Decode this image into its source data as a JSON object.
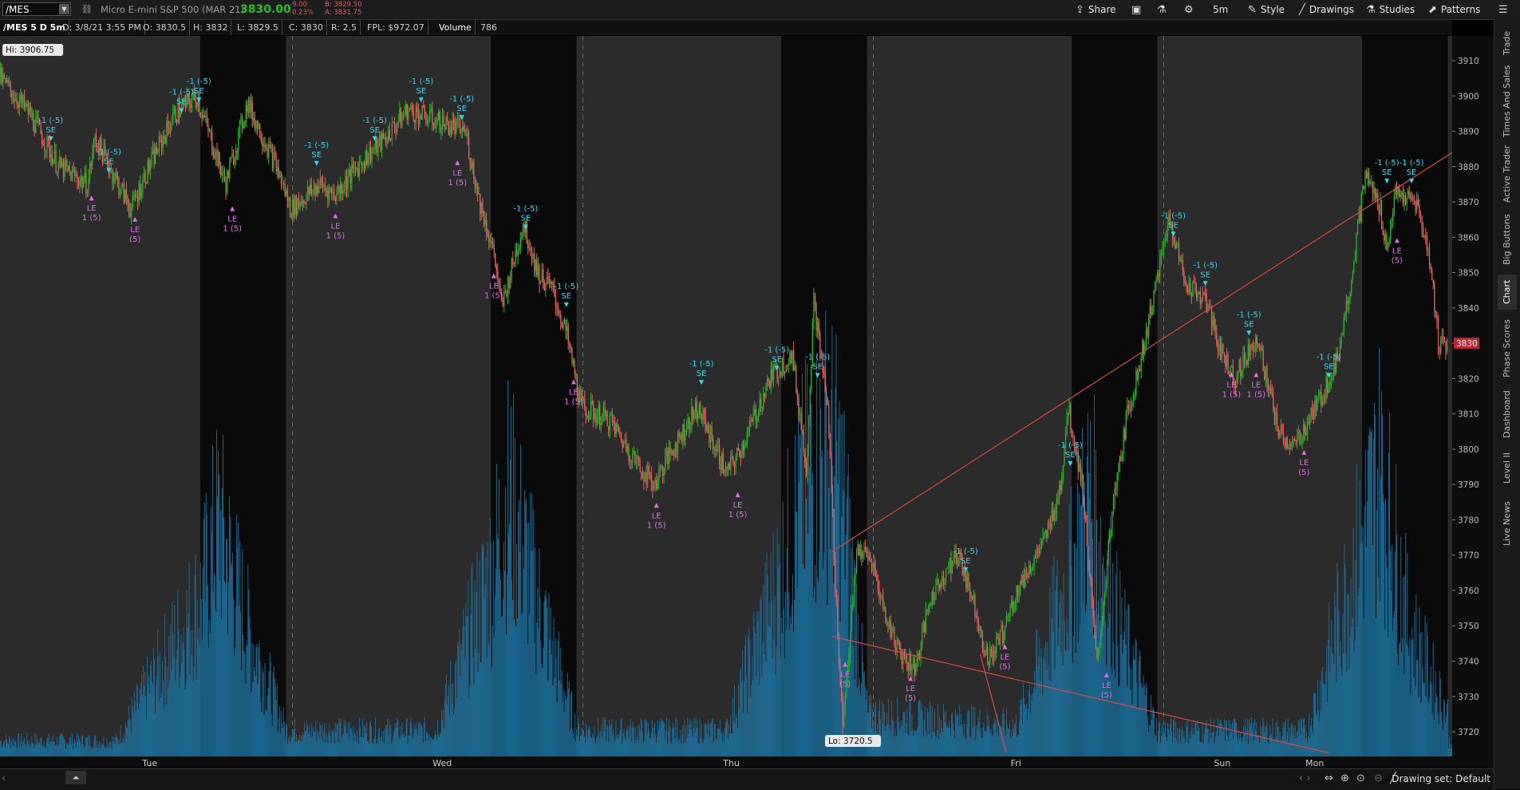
{
  "header": {
    "symbol": "/MES",
    "description": "Micro E-mini S&P 500 (MAR 21)",
    "last": "3830.00",
    "change": "-9.00",
    "change_pct": "-0.23%",
    "bid": "B: 3829.50",
    "ask": "A: 3831.75"
  },
  "toolbar": {
    "share": "Share",
    "timeframe": "5m",
    "style": "Style",
    "drawings": "Drawings",
    "studies": "Studies",
    "patterns": "Patterns"
  },
  "infobar": {
    "title": "/MES 5 D 5m",
    "date": "D: 3/8/21 3:55 PM",
    "open": "O: 3830.5",
    "high": "H: 3832",
    "low": "L: 3829.5",
    "close": "C: 3830",
    "range": "R: 2.5",
    "fpl": "FPL: $972.07",
    "volume_label": "Volume",
    "volume_value": "786"
  },
  "sidebar": {
    "tabs": [
      "Trade",
      "Times And Sales",
      "Active Trader",
      "Big Buttons",
      "Chart",
      "Phase Scores",
      "Dashboard",
      "Level II",
      "Live News"
    ],
    "active": "Chart"
  },
  "bottom": {
    "drawing_set": "Drawing set: Default"
  },
  "colors": {
    "up": "#22b822",
    "down": "#e86060",
    "volume": "#1d6f9a",
    "trendline": "#e04848",
    "se": "#35d7f0",
    "le": "#e070e8",
    "session_dark": "#0a0a0a",
    "session_light": "#2b2b2b"
  },
  "chart_data": {
    "type": "candlestick",
    "ylim": [
      3713,
      3917
    ],
    "y_ticks": [
      3720,
      3730,
      3740,
      3750,
      3760,
      3770,
      3780,
      3790,
      3800,
      3810,
      3820,
      3830,
      3840,
      3850,
      3860,
      3870,
      3880,
      3890,
      3900,
      3910
    ],
    "x_labels": [
      {
        "label": "Tue",
        "t": 0.065
      },
      {
        "label": "Wed",
        "t": 0.265
      },
      {
        "label": "Thu",
        "t": 0.465
      },
      {
        "label": "Fri",
        "t": 0.663
      },
      {
        "label": "Sun",
        "t": 0.803
      },
      {
        "label": "Mon",
        "t": 0.866
      }
    ],
    "dark_sessions": [
      [
        0.138,
        0.197
      ],
      [
        0.338,
        0.397
      ],
      [
        0.538,
        0.597
      ],
      [
        0.738,
        0.797
      ],
      [
        0.938,
        0.997
      ]
    ],
    "hi_label": "Hi: 3906.75",
    "lo_label": "Lo: 3720.5",
    "price_tag": "3830",
    "path": [
      [
        0.0,
        3905
      ],
      [
        0.02,
        3895
      ],
      [
        0.04,
        3880
      ],
      [
        0.06,
        3875
      ],
      [
        0.065,
        3888
      ],
      [
        0.09,
        3868
      ],
      [
        0.1,
        3878
      ],
      [
        0.12,
        3895
      ],
      [
        0.135,
        3900
      ],
      [
        0.155,
        3875
      ],
      [
        0.17,
        3898
      ],
      [
        0.19,
        3880
      ],
      [
        0.2,
        3868
      ],
      [
        0.22,
        3875
      ],
      [
        0.23,
        3872
      ],
      [
        0.25,
        3882
      ],
      [
        0.265,
        3888
      ],
      [
        0.28,
        3896
      ],
      [
        0.3,
        3893
      ],
      [
        0.32,
        3890
      ],
      [
        0.33,
        3870
      ],
      [
        0.34,
        3855
      ],
      [
        0.345,
        3840
      ],
      [
        0.36,
        3864
      ],
      [
        0.37,
        3850
      ],
      [
        0.38,
        3845
      ],
      [
        0.39,
        3832
      ],
      [
        0.4,
        3812
      ],
      [
        0.42,
        3808
      ],
      [
        0.44,
        3795
      ],
      [
        0.45,
        3790
      ],
      [
        0.46,
        3798
      ],
      [
        0.48,
        3812
      ],
      [
        0.5,
        3793
      ],
      [
        0.51,
        3800
      ],
      [
        0.53,
        3820
      ],
      [
        0.545,
        3827
      ],
      [
        0.555,
        3795
      ],
      [
        0.56,
        3842
      ],
      [
        0.57,
        3810
      ],
      [
        0.575,
        3760
      ],
      [
        0.58,
        3722
      ],
      [
        0.59,
        3772
      ],
      [
        0.6,
        3768
      ],
      [
        0.61,
        3752
      ],
      [
        0.62,
        3742
      ],
      [
        0.63,
        3738
      ],
      [
        0.64,
        3757
      ],
      [
        0.65,
        3765
      ],
      [
        0.66,
        3770
      ],
      [
        0.67,
        3757
      ],
      [
        0.68,
        3740
      ],
      [
        0.69,
        3748
      ],
      [
        0.7,
        3760
      ],
      [
        0.72,
        3775
      ],
      [
        0.73,
        3790
      ],
      [
        0.735,
        3812
      ],
      [
        0.745,
        3790
      ],
      [
        0.755,
        3738
      ],
      [
        0.765,
        3780
      ],
      [
        0.775,
        3808
      ],
      [
        0.785,
        3825
      ],
      [
        0.795,
        3845
      ],
      [
        0.805,
        3866
      ],
      [
        0.815,
        3848
      ],
      [
        0.83,
        3842
      ],
      [
        0.84,
        3828
      ],
      [
        0.85,
        3820
      ],
      [
        0.865,
        3832
      ],
      [
        0.88,
        3805
      ],
      [
        0.89,
        3800
      ],
      [
        0.91,
        3815
      ],
      [
        0.92,
        3825
      ],
      [
        0.93,
        3848
      ],
      [
        0.94,
        3878
      ],
      [
        0.95,
        3868
      ],
      [
        0.955,
        3856
      ],
      [
        0.96,
        3872
      ],
      [
        0.975,
        3870
      ],
      [
        0.985,
        3852
      ],
      [
        0.99,
        3830
      ],
      [
        0.997,
        3830
      ]
    ],
    "volume_profile": [
      [
        0.0,
        0.03
      ],
      [
        0.08,
        0.03
      ],
      [
        0.138,
        0.3
      ],
      [
        0.15,
        0.45
      ],
      [
        0.17,
        0.25
      ],
      [
        0.197,
        0.05
      ],
      [
        0.3,
        0.05
      ],
      [
        0.338,
        0.35
      ],
      [
        0.35,
        0.5
      ],
      [
        0.37,
        0.3
      ],
      [
        0.397,
        0.05
      ],
      [
        0.5,
        0.05
      ],
      [
        0.538,
        0.35
      ],
      [
        0.55,
        0.48
      ],
      [
        0.57,
        0.6
      ],
      [
        0.58,
        0.5
      ],
      [
        0.597,
        0.08
      ],
      [
        0.7,
        0.06
      ],
      [
        0.738,
        0.35
      ],
      [
        0.75,
        0.5
      ],
      [
        0.77,
        0.25
      ],
      [
        0.797,
        0.05
      ],
      [
        0.9,
        0.05
      ],
      [
        0.938,
        0.42
      ],
      [
        0.95,
        0.55
      ],
      [
        0.97,
        0.25
      ],
      [
        0.997,
        0.08
      ]
    ],
    "trendlines": [
      [
        [
          0.573,
          3771
        ],
        [
          1.0,
          3884
        ]
      ],
      [
        [
          0.573,
          3747
        ],
        [
          0.915,
          3714
        ]
      ],
      [
        [
          0.675,
          3742
        ],
        [
          0.693,
          3714
        ]
      ]
    ],
    "signals": [
      {
        "t": 0.035,
        "p": 3887,
        "type": "SE",
        "label": "-1 (-5)"
      },
      {
        "t": 0.075,
        "p": 3878,
        "type": "SE",
        "label": "-1 (-5)"
      },
      {
        "t": 0.125,
        "p": 3895,
        "type": "SE",
        "label": "-1 (-5)"
      },
      {
        "t": 0.137,
        "p": 3898,
        "type": "SE",
        "label": "-1 (-5)"
      },
      {
        "t": 0.218,
        "p": 3880,
        "type": "SE",
        "label": "-1 (-5)"
      },
      {
        "t": 0.258,
        "p": 3887,
        "type": "SE",
        "label": "-1 (-5)"
      },
      {
        "t": 0.29,
        "p": 3898,
        "type": "SE",
        "label": "-1 (-5)"
      },
      {
        "t": 0.318,
        "p": 3893,
        "type": "SE",
        "label": "-1 (-5)"
      },
      {
        "t": 0.362,
        "p": 3862,
        "type": "SE",
        "label": "-1 (-5)"
      },
      {
        "t": 0.39,
        "p": 3840,
        "type": "SE",
        "label": "-1 (-5)"
      },
      {
        "t": 0.483,
        "p": 3818,
        "type": "SE",
        "label": "-1 (-5)"
      },
      {
        "t": 0.535,
        "p": 3822,
        "type": "SE",
        "label": "-1 (-5)"
      },
      {
        "t": 0.563,
        "p": 3820,
        "type": "SE",
        "label": "-1 (-5)"
      },
      {
        "t": 0.665,
        "p": 3765,
        "type": "SE",
        "label": "-1 (-5)"
      },
      {
        "t": 0.737,
        "p": 3795,
        "type": "SE",
        "label": "-1 (-5)"
      },
      {
        "t": 0.808,
        "p": 3860,
        "type": "SE",
        "label": "-1 (-5)"
      },
      {
        "t": 0.83,
        "p": 3846,
        "type": "SE",
        "label": "-1 (-5)"
      },
      {
        "t": 0.86,
        "p": 3832,
        "type": "SE",
        "label": "-1 (-5)"
      },
      {
        "t": 0.915,
        "p": 3820,
        "type": "SE",
        "label": "-1 (-5)"
      },
      {
        "t": 0.955,
        "p": 3875,
        "type": "SE",
        "label": "-1 (-5)"
      },
      {
        "t": 0.972,
        "p": 3875,
        "type": "SE",
        "label": "-1 (-5)"
      },
      {
        "t": 0.063,
        "p": 3872,
        "type": "LE",
        "label": "1 (5)"
      },
      {
        "t": 0.093,
        "p": 3866,
        "type": "LE",
        "label": "(5)"
      },
      {
        "t": 0.16,
        "p": 3869,
        "type": "LE",
        "label": "1 (5)"
      },
      {
        "t": 0.231,
        "p": 3867,
        "type": "LE",
        "label": "1 (5)"
      },
      {
        "t": 0.315,
        "p": 3882,
        "type": "LE",
        "label": "1 (5)"
      },
      {
        "t": 0.34,
        "p": 3850,
        "type": "LE",
        "label": "1 (5)"
      },
      {
        "t": 0.395,
        "p": 3820,
        "type": "LE",
        "label": "1 (5)"
      },
      {
        "t": 0.452,
        "p": 3785,
        "type": "LE",
        "label": "1 (5)"
      },
      {
        "t": 0.508,
        "p": 3788,
        "type": "LE",
        "label": "1 (5)"
      },
      {
        "t": 0.582,
        "p": 3740,
        "type": "LE",
        "label": "(5)"
      },
      {
        "t": 0.627,
        "p": 3736,
        "type": "LE",
        "label": "(5)"
      },
      {
        "t": 0.692,
        "p": 3745,
        "type": "LE",
        "label": "(5)"
      },
      {
        "t": 0.762,
        "p": 3737,
        "type": "LE",
        "label": "(5)"
      },
      {
        "t": 0.848,
        "p": 3822,
        "type": "LE",
        "label": "1 (5)"
      },
      {
        "t": 0.865,
        "p": 3822,
        "type": "LE",
        "label": "1 (5)"
      },
      {
        "t": 0.898,
        "p": 3800,
        "type": "LE",
        "label": "(5)"
      },
      {
        "t": 0.962,
        "p": 3860,
        "type": "LE",
        "label": "(5)"
      }
    ]
  }
}
